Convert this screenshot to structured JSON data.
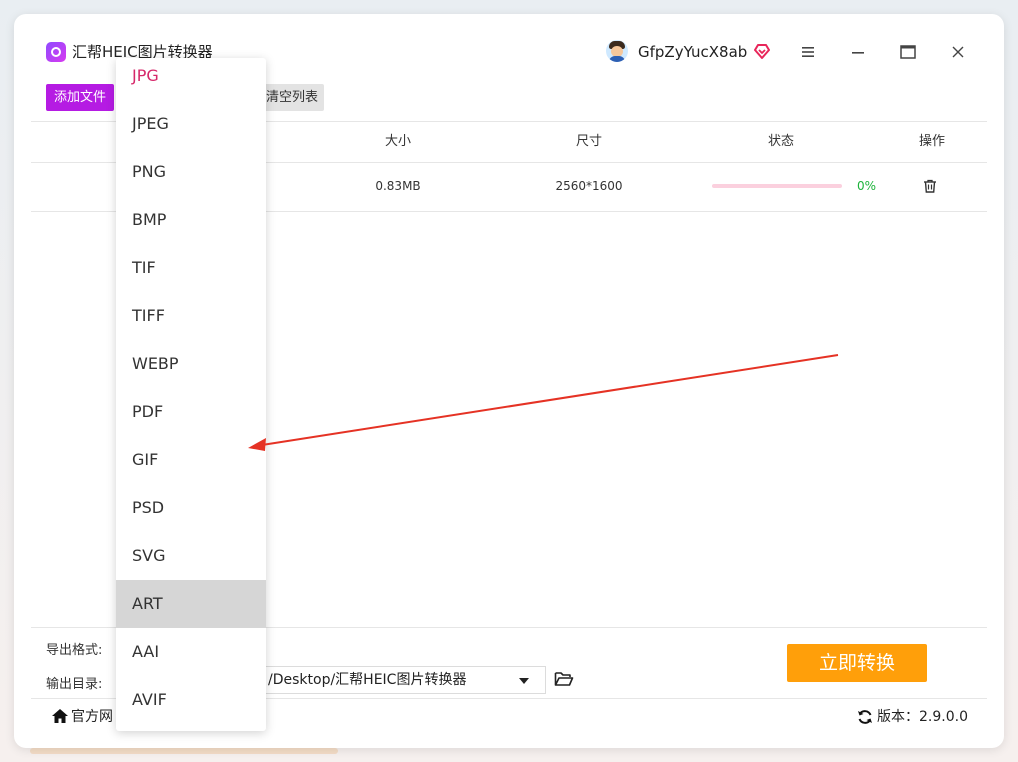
{
  "app": {
    "title": "汇帮HEIC图片转换器",
    "username": "GfpZyYucX8ab"
  },
  "toolbar": {
    "add_label": "添加文件",
    "clear_label": "清空列表"
  },
  "table": {
    "headers": {
      "size": "大小",
      "dimensions": "尺寸",
      "status": "状态",
      "actions": "操作"
    },
    "rows": [
      {
        "size": "0.83MB",
        "dimensions": "2560*1600",
        "progress_percent": 0,
        "percent_label": "0%"
      }
    ]
  },
  "output": {
    "format_label": "导出格式:",
    "dir_label": "输出目录:",
    "dir_value": "/Desktop/汇帮HEIC图片转换器",
    "convert_label": "立即转换"
  },
  "footer": {
    "site_label": "官方网",
    "version_label": "版本：2.9.0.0"
  },
  "format_dropdown": {
    "options": [
      "JPG",
      "JPEG",
      "PNG",
      "BMP",
      "TIF",
      "TIFF",
      "WEBP",
      "PDF",
      "GIF",
      "PSD",
      "SVG",
      "ART",
      "AAI",
      "AVIF"
    ],
    "selected": "JPG",
    "hovered": "ART"
  },
  "colors": {
    "accent_purple": "#b51be3",
    "convert_orange": "#ff9f0a",
    "selected_pink": "#d6286a",
    "progress_green": "#1db33b",
    "annotation_red": "#e53224"
  },
  "icons": {
    "logo": "app-logo-icon",
    "vip": "vip-diamond-icon",
    "menu": "hamburger-menu-icon",
    "minimize": "minimize-icon",
    "maximize": "maximize-icon",
    "close": "close-icon",
    "trash": "trash-icon",
    "folder": "folder-open-icon",
    "home": "home-icon",
    "refresh": "refresh-icon"
  }
}
